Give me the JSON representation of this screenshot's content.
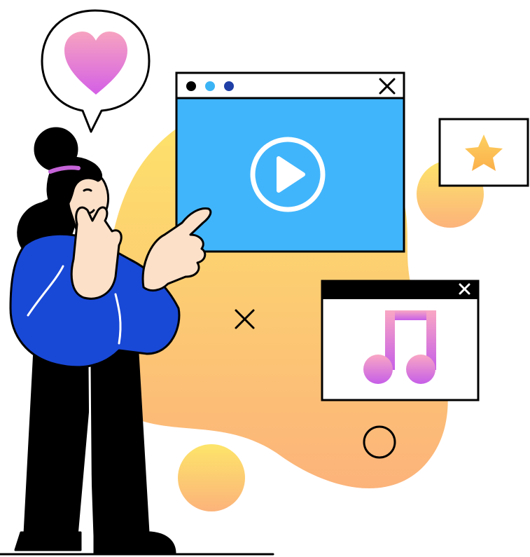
{
  "scene": {
    "background": "#ffffff",
    "blob_gradient": [
      "#fde36a",
      "#fcb37a"
    ],
    "heart_gradient": [
      "#f7a3c0",
      "#d45fe6"
    ],
    "music_gradient": [
      "#f9a7c4",
      "#c65ee8"
    ]
  },
  "video_window": {
    "dot_colors": [
      "#000000",
      "#3bb4f5",
      "#1f3fa6"
    ],
    "close_icon": "close-icon",
    "screen_color": "#41b5fb",
    "play_icon": "play-icon"
  },
  "music_window": {
    "titlebar_color": "#000000",
    "close_icon": "close-icon",
    "note_icon": "music-note-icon"
  },
  "star_card": {
    "icon": "star-icon",
    "star_color": "#fdbe4e"
  },
  "speech_bubble": {
    "icon": "heart-icon"
  },
  "person": {
    "sweater_color": "#1848d6",
    "skin_color": "#fce0c8",
    "hair_tie_color": "#c563d8"
  }
}
